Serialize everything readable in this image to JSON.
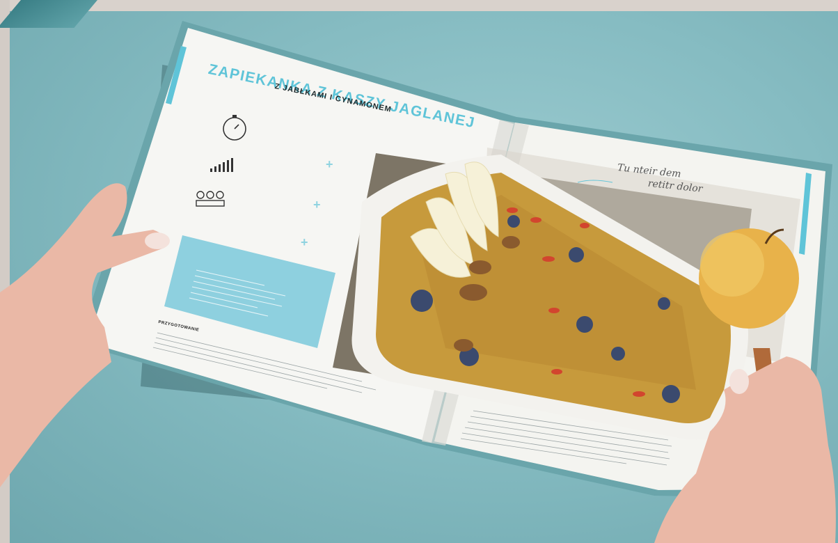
{
  "recipe": {
    "title": "ZAPIEKANKA Z KASZY JAGLANEJ",
    "subtitle": "Z JABŁKAMI I CYNAMONEM"
  },
  "handwritten_note": {
    "line1": "Tu nteir dem",
    "line2": "retitr dolor"
  },
  "prep_heading": "PRZYGOTOWANIE",
  "colors": {
    "accent": "#5fc4d8",
    "background": "#86bcc2",
    "page": "#f6f6f3"
  },
  "icons": [
    "stopwatch-icon",
    "signal-bars-icon",
    "servings-icon",
    "plus-icon"
  ]
}
